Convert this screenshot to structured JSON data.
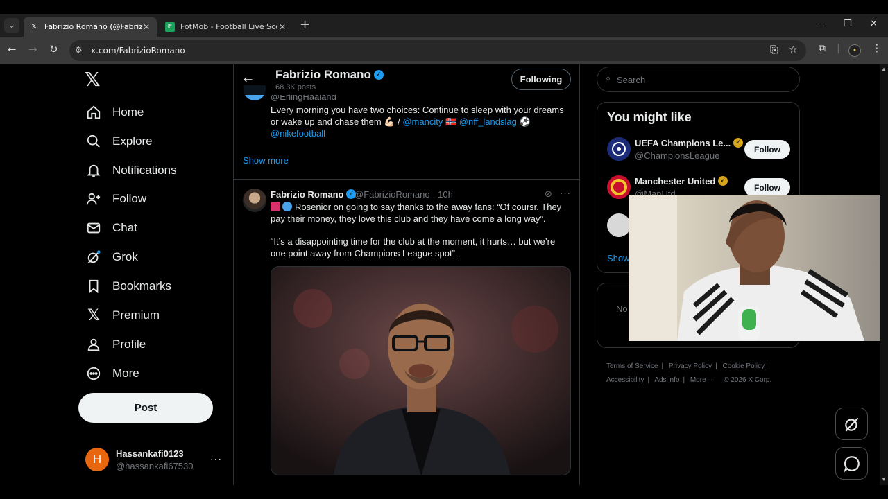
{
  "browser": {
    "tabs": [
      {
        "title": "Fabrizio Romano (@FabrizioRomano",
        "active": true
      },
      {
        "title": "FotMob - Football Live Scores",
        "active": false
      }
    ],
    "url": "x.com/FabrizioRomano",
    "new_tab": "+",
    "window_controls": {
      "minimize": "—",
      "restore": "❐",
      "close": "✕"
    }
  },
  "nav": {
    "items": [
      {
        "label": "Home",
        "icon": "home-icon"
      },
      {
        "label": "Explore",
        "icon": "search-icon"
      },
      {
        "label": "Notifications",
        "icon": "bell-icon"
      },
      {
        "label": "Follow",
        "icon": "follow-icon"
      },
      {
        "label": "Chat",
        "icon": "mail-icon"
      },
      {
        "label": "Grok",
        "icon": "grok-icon"
      },
      {
        "label": "Bookmarks",
        "icon": "bookmark-icon"
      },
      {
        "label": "Premium",
        "icon": "x-logo-icon"
      },
      {
        "label": "Profile",
        "icon": "person-icon"
      },
      {
        "label": "More",
        "icon": "more-circle-icon"
      }
    ],
    "post_label": "Post",
    "account": {
      "avatar_letter": "H",
      "name": "Hassankafi0123",
      "handle": "@hassankafi67530",
      "more": "···"
    }
  },
  "profile_header": {
    "name": "Fabrizio Romano",
    "posts_count": "68.3K posts",
    "following_label": "Following"
  },
  "previous_tweet": {
    "handle": "@ErlingHaaland",
    "text_part1": "Every morning you have two choices: Continue to sleep with your dreams or wake up and chase them 💪🏻 / ",
    "mention1": "@mancity",
    "mention2": "@nff_landslag",
    "mention3": "@nikefootball",
    "show_more": "Show more"
  },
  "tweet": {
    "author": "Fabrizio Romano",
    "handle_time": "@FabrizioRomano · 10h",
    "line1": "Rosenior on going to say thanks to the away fans: “Of coursr. They pay their money, they love this club and they have come a long way”.",
    "line2": "“It’s a disappointing time for the club at the moment, it hurts… but we’re one point away from Champions League spot”."
  },
  "sidebar": {
    "search_placeholder": "Search",
    "you_might_like": "You might like",
    "suggestions": [
      {
        "name": "UEFA Champions Le...",
        "handle": "@ChampionsLeague",
        "follow_label": "Follow"
      },
      {
        "name": "Manchester United",
        "handle": "@ManUtd",
        "follow_label": "Follow"
      }
    ],
    "show_more": "Show",
    "card2_text": "No",
    "footer": {
      "terms": "Terms of Service",
      "privacy": "Privacy Policy",
      "cookie": "Cookie Policy",
      "accessibility": "Accessibility",
      "ads": "Ads info",
      "more": "More ···",
      "copyright": "© 2026 X Corp."
    }
  },
  "colors": {
    "background": "#000000",
    "text_primary": "#e7e9ea",
    "text_secondary": "#71767b",
    "accent": "#1d9bf0",
    "border": "#2f3336",
    "gold_badge": "#d6a41a"
  }
}
